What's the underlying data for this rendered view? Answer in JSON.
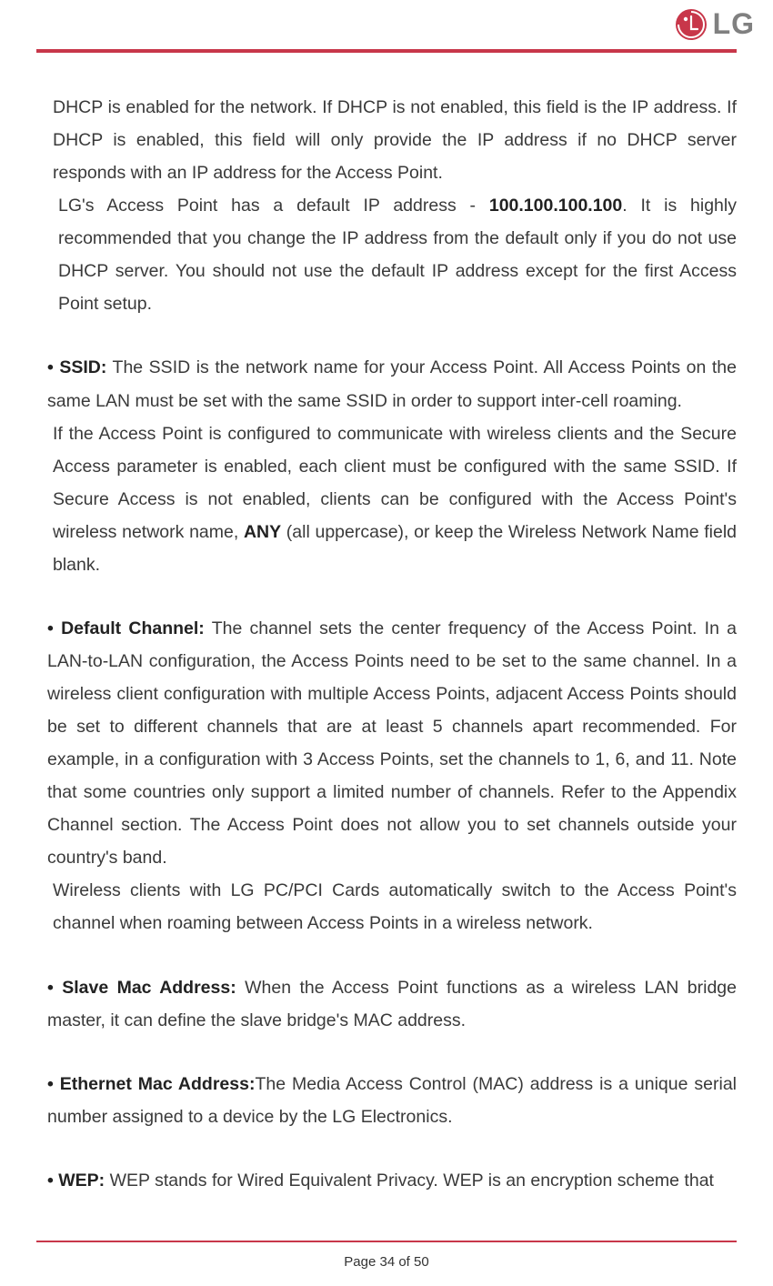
{
  "brand": {
    "name": "LG"
  },
  "footer": {
    "page_text": "Page 34 of 50"
  },
  "p1a": "DHCP is enabled for the network. If DHCP is not enabled, this field is the IP address. If DHCP is enabled, this field will only provide the IP address if no DHCP server responds with an IP address for the Access Point.",
  "p1b_a": "LG's Access Point has a default IP address - ",
  "p1b_ip": "100.100.100.100",
  "p1b_b": ". It is highly recommended that you change the IP address from the default only if you do not use DHCP server. You should not use the default IP address except for the first Access Point setup.",
  "ssid": {
    "label": "SSID:",
    "t1": " The SSID is the network name for your Access Point. All Access Points on the same LAN must be set with the same SSID in order to support inter-cell roaming.",
    "t2a": "If the Access Point is configured to communicate with wireless clients and the Secure Access parameter is enabled, each client must be configured with the same SSID. If Secure Access is not enabled, clients can be configured with the Access Point's wireless network name, ",
    "any": "ANY",
    "t2b": " (all uppercase), or keep the Wireless Network Name field blank."
  },
  "chan": {
    "label": "Default Channel:",
    "t1": " The channel sets the center frequency of the Access Point. In a LAN-to-LAN configuration, the Access Points need to be set to the same channel. In a wireless client configuration with multiple Access Points, adjacent Access Points should be set to different channels that are at least 5 channels apart recommended. For example, in a configuration with 3 Access Points, set the channels to 1, 6, and 11. Note that some countries only support a limited number of channels. Refer to the Appendix Channel section. The Access Point does not allow you to set channels outside your country's band.",
    "t2": "Wireless clients with LG PC/PCI Cards automatically switch to the Access Point's channel when roaming between Access Points in a wireless network."
  },
  "slave": {
    "label": "Slave Mac Address:",
    "t": " When the Access Point functions as a wireless LAN bridge master, it can define the slave bridge's MAC address."
  },
  "eth": {
    "label": "Ethernet Mac Address:",
    "t": "The Media Access Control (MAC) address is a unique serial number assigned to a device by the LG Electronics."
  },
  "wep": {
    "label": "WEP:",
    "t": " WEP stands for Wired Equivalent Privacy. WEP is an encryption scheme that"
  }
}
